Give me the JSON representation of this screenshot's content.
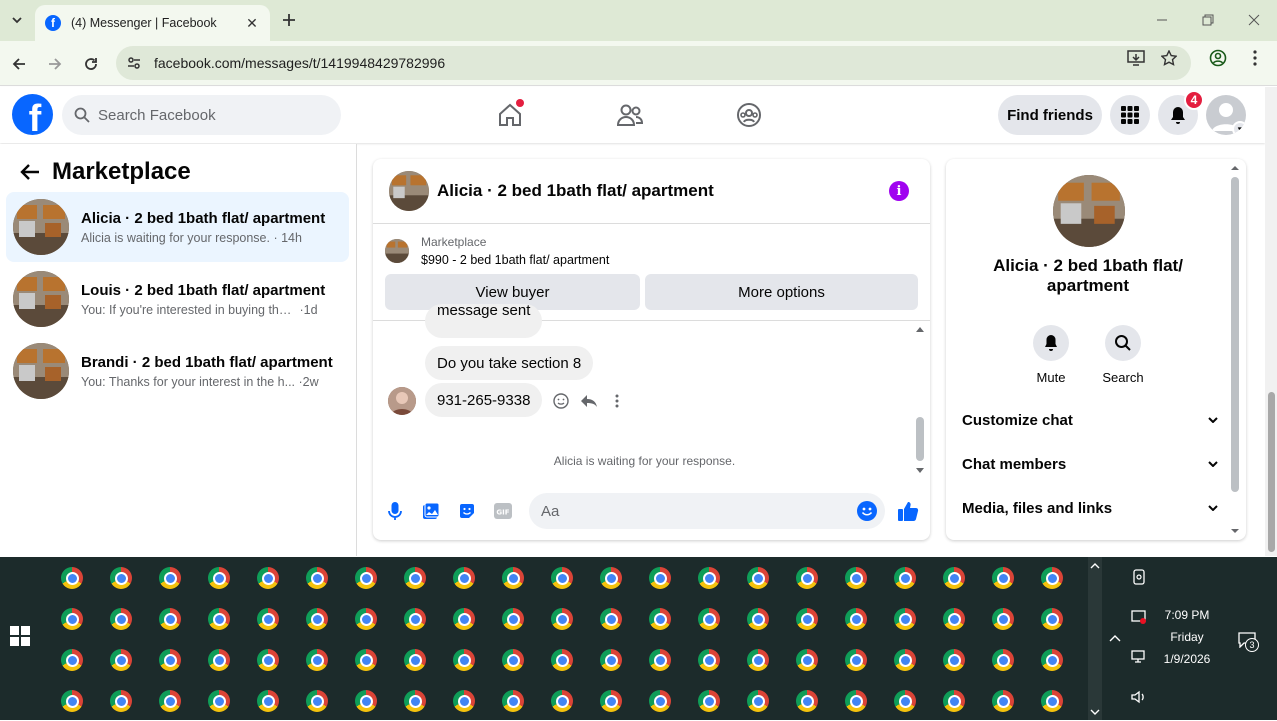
{
  "browser": {
    "tab_title": "(4) Messenger | Facebook",
    "url": "facebook.com/messages/t/1419948429782996"
  },
  "fb_header": {
    "search_placeholder": "Search Facebook",
    "find_friends": "Find friends",
    "notifications_count": "4"
  },
  "left": {
    "title": "Marketplace",
    "conversations": [
      {
        "name": "Alicia · 2 bed 1bath flat/ apartment",
        "preview": "Alicia is waiting for your response.",
        "time": "14h"
      },
      {
        "name": "Louis · 2 bed 1bath flat/ apartment",
        "preview": "You: If you're interested in buying the ...",
        "time": "1d"
      },
      {
        "name": "Brandi · 2 bed 1bath flat/ apartment",
        "preview": "You: Thanks for your interest in the h...",
        "time": "2w"
      }
    ]
  },
  "chat": {
    "title": "Alicia · 2 bed 1bath flat/ apartment",
    "marketplace_label": "Marketplace",
    "listing": "$990 - 2 bed 1bath flat/ apartment",
    "view_buyer": "View buyer",
    "more_options": "More options",
    "messages": [
      "message sent",
      "Do you take section 8",
      "931-265-9338"
    ],
    "waiting": "Alicia is waiting for your response.",
    "composer_placeholder": "Aa"
  },
  "right": {
    "name": "Alicia · 2 bed 1bath flat/ apartment",
    "mute": "Mute",
    "search": "Search",
    "rows": [
      "Customize chat",
      "Chat members",
      "Media, files and links"
    ]
  },
  "taskbar": {
    "time": "7:09 PM",
    "day": "Friday",
    "date": "1/9/2026",
    "notification_count": "3"
  }
}
